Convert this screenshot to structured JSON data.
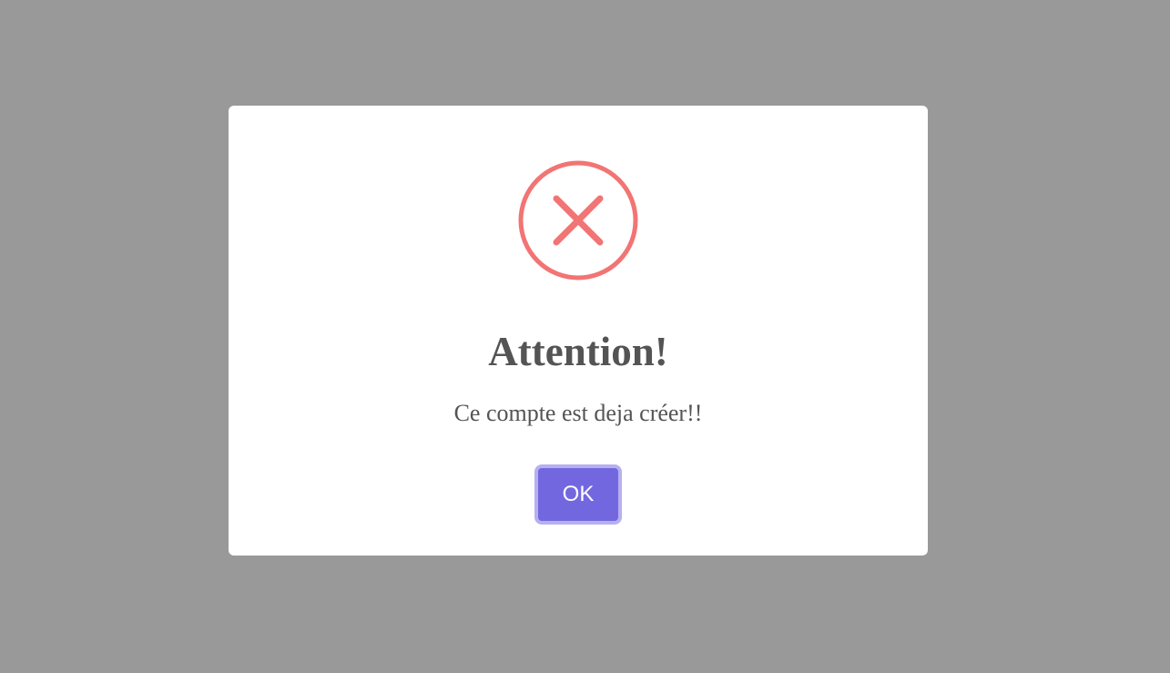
{
  "dialog": {
    "title": "Attention!",
    "message": "Ce compte est deja créer!!",
    "confirm_label": "OK",
    "icon": "error-x-icon"
  },
  "colors": {
    "overlay": "#999999",
    "modal_background": "#ffffff",
    "error_icon": "#f27474",
    "text": "#545454",
    "button": "#7367e0",
    "button_focus_ring": "#b6b0f0"
  }
}
